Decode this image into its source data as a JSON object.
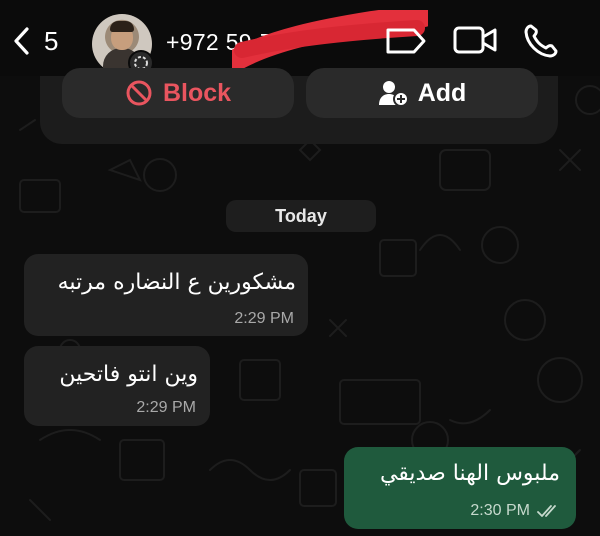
{
  "header": {
    "unread_count": "5",
    "phone_number": "+972 59-7",
    "icons": [
      "chevron-left-icon",
      "avatar",
      "label-tag-icon",
      "video-call-icon",
      "phone-call-icon"
    ]
  },
  "actions": {
    "block_label": "Block",
    "add_label": "Add",
    "block_color": "#e9555f"
  },
  "chat": {
    "date_label": "Today",
    "messages": [
      {
        "direction": "incoming",
        "text": "مشكورين ع النضاره مرتبه",
        "time": "2:29 PM"
      },
      {
        "direction": "incoming",
        "text": "وين انتو فاتحين",
        "time": "2:29 PM"
      },
      {
        "direction": "outgoing",
        "text": "ملبوس الهنا صديقي",
        "time": "2:30 PM",
        "status": "read-double-check"
      }
    ]
  },
  "colors": {
    "background": "#0d0d0d",
    "incoming_bubble": "#222222",
    "outgoing_bubble": "#1f5a3d",
    "read_ticks": "#c6d9cd"
  }
}
